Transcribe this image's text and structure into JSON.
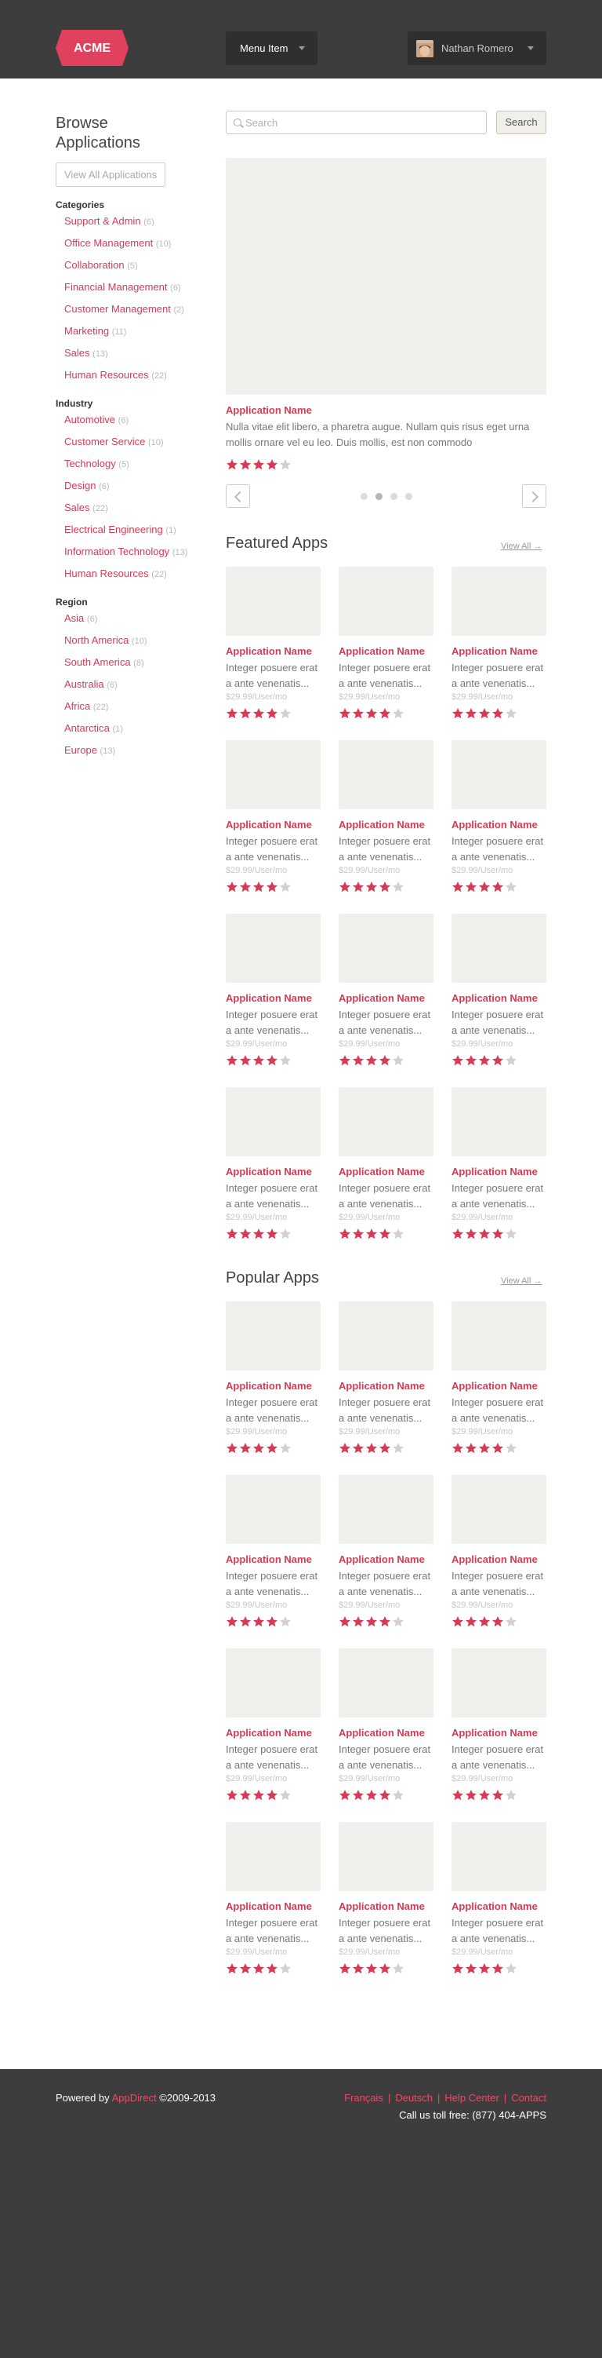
{
  "header": {
    "logo_text": "ACME",
    "menu_label": "Menu Item",
    "user_name": "Nathan Romero"
  },
  "sidebar": {
    "title_line1": "Browse",
    "title_line2": "Applications",
    "view_all_label": "View All Applications",
    "groups": [
      {
        "heading": "Categories",
        "items": [
          {
            "label": "Support & Admin",
            "count": "(6)"
          },
          {
            "label": "Office Management",
            "count": "(10)"
          },
          {
            "label": "Collaboration",
            "count": "(5)"
          },
          {
            "label": "Financial Management",
            "count": "(6)"
          },
          {
            "label": "Customer Management",
            "count": "(2)"
          },
          {
            "label": "Marketing",
            "count": "(11)"
          },
          {
            "label": "Sales",
            "count": "(13)"
          },
          {
            "label": "Human Resources",
            "count": "(22)"
          }
        ]
      },
      {
        "heading": "Industry",
        "items": [
          {
            "label": "Automotive",
            "count": "(6)"
          },
          {
            "label": "Customer Service",
            "count": "(10)"
          },
          {
            "label": "Technology",
            "count": "(5)"
          },
          {
            "label": "Design",
            "count": "(6)"
          },
          {
            "label": "Sales",
            "count": "(22)"
          },
          {
            "label": "Electrical Engineering",
            "count": "(1)"
          },
          {
            "label": "Information Technology",
            "count": "(13)"
          },
          {
            "label": "Human Resources",
            "count": "(22)"
          }
        ]
      },
      {
        "heading": "Region",
        "items": [
          {
            "label": "Asia",
            "count": "(6)"
          },
          {
            "label": "North America",
            "count": "(10)"
          },
          {
            "label": "South America",
            "count": "(8)"
          },
          {
            "label": "Australia",
            "count": "(6)"
          },
          {
            "label": "Africa",
            "count": "(22)"
          },
          {
            "label": "Antarctica",
            "count": "(1)"
          },
          {
            "label": "Europe",
            "count": "(13)"
          }
        ]
      }
    ]
  },
  "search": {
    "placeholder": "Search",
    "button_label": "Search"
  },
  "hero": {
    "title": "Application Name",
    "description": "Nulla vitae elit libero, a pharetra augue. Nullam quis risus eget urna mollis ornare vel eu leo. Duis mollis, est non commodo",
    "rating": 4,
    "slide_count": 4,
    "active_slide": 2
  },
  "sections": [
    {
      "title": "Featured Apps",
      "view_all": "View All →",
      "apps": [
        {
          "name": "Application Name",
          "desc1": "Integer posuere erat",
          "desc2": "a ante venenatis...",
          "price": "$29.99/User/mo",
          "rating": 4
        },
        {
          "name": "Application Name",
          "desc1": "Integer posuere erat",
          "desc2": "a ante venenatis...",
          "price": "$29.99/User/mo",
          "rating": 4
        },
        {
          "name": "Application Name",
          "desc1": "Integer posuere erat",
          "desc2": "a ante venenatis...",
          "price": "$29.99/User/mo",
          "rating": 4
        },
        {
          "name": "Application Name",
          "desc1": "Integer posuere erat",
          "desc2": "a ante venenatis...",
          "price": "$29.99/User/mo",
          "rating": 4
        },
        {
          "name": "Application Name",
          "desc1": "Integer posuere erat",
          "desc2": "a ante venenatis...",
          "price": "$29.99/User/mo",
          "rating": 4
        },
        {
          "name": "Application Name",
          "desc1": "Integer posuere erat",
          "desc2": "a ante venenatis...",
          "price": "$29.99/User/mo",
          "rating": 4
        },
        {
          "name": "Application Name",
          "desc1": "Integer posuere erat",
          "desc2": "a ante venenatis...",
          "price": "$29.99/User/mo",
          "rating": 4
        },
        {
          "name": "Application Name",
          "desc1": "Integer posuere erat",
          "desc2": "a ante venenatis...",
          "price": "$29.99/User/mo",
          "rating": 4
        },
        {
          "name": "Application Name",
          "desc1": "Integer posuere erat",
          "desc2": "a ante venenatis...",
          "price": "$29.99/User/mo",
          "rating": 4
        },
        {
          "name": "Application Name",
          "desc1": "Integer posuere erat",
          "desc2": "a ante venenatis...",
          "price": "$29.99/User/mo",
          "rating": 4
        },
        {
          "name": "Application Name",
          "desc1": "Integer posuere erat",
          "desc2": "a ante venenatis...",
          "price": "$29.99/User/mo",
          "rating": 4
        },
        {
          "name": "Application Name",
          "desc1": "Integer posuere erat",
          "desc2": "a ante venenatis...",
          "price": "$29.99/User/mo",
          "rating": 4
        }
      ]
    },
    {
      "title": "Popular Apps",
      "view_all": "View All →",
      "apps": [
        {
          "name": "Application Name",
          "desc1": "Integer posuere erat",
          "desc2": "a ante venenatis...",
          "price": "$29.99/User/mo",
          "rating": 4
        },
        {
          "name": "Application Name",
          "desc1": "Integer posuere erat",
          "desc2": "a ante venenatis...",
          "price": "$29.99/User/mo",
          "rating": 4
        },
        {
          "name": "Application Name",
          "desc1": "Integer posuere erat",
          "desc2": "a ante venenatis...",
          "price": "$29.99/User/mo",
          "rating": 4
        },
        {
          "name": "Application Name",
          "desc1": "Integer posuere erat",
          "desc2": "a ante venenatis...",
          "price": "$29.99/User/mo",
          "rating": 4
        },
        {
          "name": "Application Name",
          "desc1": "Integer posuere erat",
          "desc2": "a ante venenatis...",
          "price": "$29.99/User/mo",
          "rating": 4
        },
        {
          "name": "Application Name",
          "desc1": "Integer posuere erat",
          "desc2": "a ante venenatis...",
          "price": "$29.99/User/mo",
          "rating": 4
        },
        {
          "name": "Application Name",
          "desc1": "Integer posuere erat",
          "desc2": "a ante venenatis...",
          "price": "$29.99/User/mo",
          "rating": 4
        },
        {
          "name": "Application Name",
          "desc1": "Integer posuere erat",
          "desc2": "a ante venenatis...",
          "price": "$29.99/User/mo",
          "rating": 4
        },
        {
          "name": "Application Name",
          "desc1": "Integer posuere erat",
          "desc2": "a ante venenatis...",
          "price": "$29.99/User/mo",
          "rating": 4
        },
        {
          "name": "Application Name",
          "desc1": "Integer posuere erat",
          "desc2": "a ante venenatis...",
          "price": "$29.99/User/mo",
          "rating": 4
        },
        {
          "name": "Application Name",
          "desc1": "Integer posuere erat",
          "desc2": "a ante venenatis...",
          "price": "$29.99/User/mo",
          "rating": 4
        },
        {
          "name": "Application Name",
          "desc1": "Integer posuere erat",
          "desc2": "a ante venenatis...",
          "price": "$29.99/User/mo",
          "rating": 4
        }
      ]
    }
  ],
  "footer": {
    "powered_prefix": "Powered by",
    "powered_brand": "AppDirect",
    "powered_suffix": "©2009-2013",
    "links": [
      "Français",
      "Deutsch",
      "Help Center",
      "Contact"
    ],
    "toll_free": "Call us toll free: (877) 404-APPS"
  },
  "colors": {
    "accent": "#d63a55",
    "header_bg": "#3d3d3d",
    "star_on": "#d63a55",
    "star_off": "#d0d0d0"
  }
}
